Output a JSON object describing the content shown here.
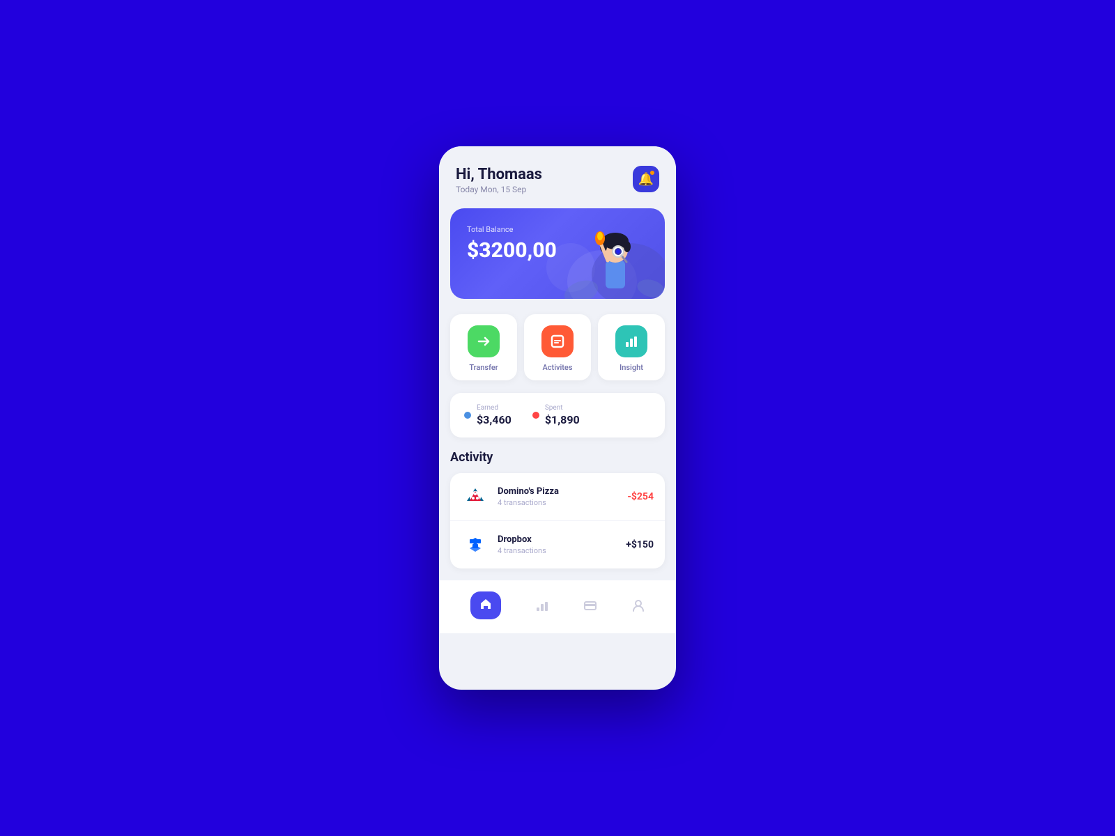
{
  "header": {
    "greeting": "Hi, Thomaas",
    "date": "Today Mon, 15 Sep"
  },
  "notification": {
    "label": "notification"
  },
  "balance_card": {
    "label": "Total Balance",
    "amount": "$3200,00"
  },
  "quick_actions": [
    {
      "id": "transfer",
      "label": "Transfer",
      "color": "green",
      "icon": "✈"
    },
    {
      "id": "activites",
      "label": "Activites",
      "color": "orange",
      "icon": "🏠"
    },
    {
      "id": "insight",
      "label": "Insight",
      "color": "teal",
      "icon": "📊"
    }
  ],
  "stats": {
    "earned": {
      "label": "Earned",
      "value": "$3,460"
    },
    "spent": {
      "label": "Spent",
      "value": "$1,890"
    }
  },
  "activity": {
    "section_title": "Activity",
    "items": [
      {
        "name": "Domino's Pizza",
        "transactions": "4 transactions",
        "amount": "-$254",
        "type": "negative"
      },
      {
        "name": "Dropbox",
        "transactions": "4 transactions",
        "amount": "+$150",
        "type": "positive"
      }
    ]
  },
  "bottom_nav": [
    {
      "id": "home",
      "label": "Home",
      "active": true
    },
    {
      "id": "stats",
      "label": "Stats",
      "active": false
    },
    {
      "id": "cards",
      "label": "Cards",
      "active": false
    },
    {
      "id": "profile",
      "label": "Profile",
      "active": false
    }
  ]
}
